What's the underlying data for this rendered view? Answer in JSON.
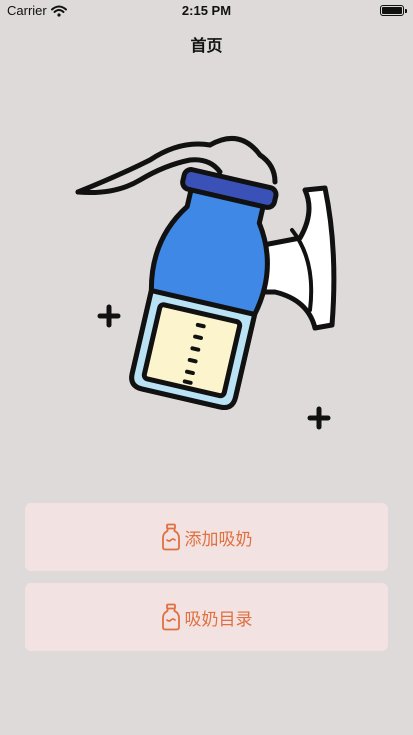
{
  "status_bar": {
    "carrier": "Carrier",
    "time": "2:15 PM",
    "wifi_icon": "wifi-icon",
    "battery_icon": "battery-icon"
  },
  "nav": {
    "title": "首页"
  },
  "hero": {
    "illustration": "breast-pump-illustration"
  },
  "actions": {
    "add_label": "添加吸奶",
    "list_label": "吸奶目录",
    "icon": "milk-bottle-icon",
    "accent_color": "#e0703f",
    "button_bg": "#f2e2e1"
  }
}
